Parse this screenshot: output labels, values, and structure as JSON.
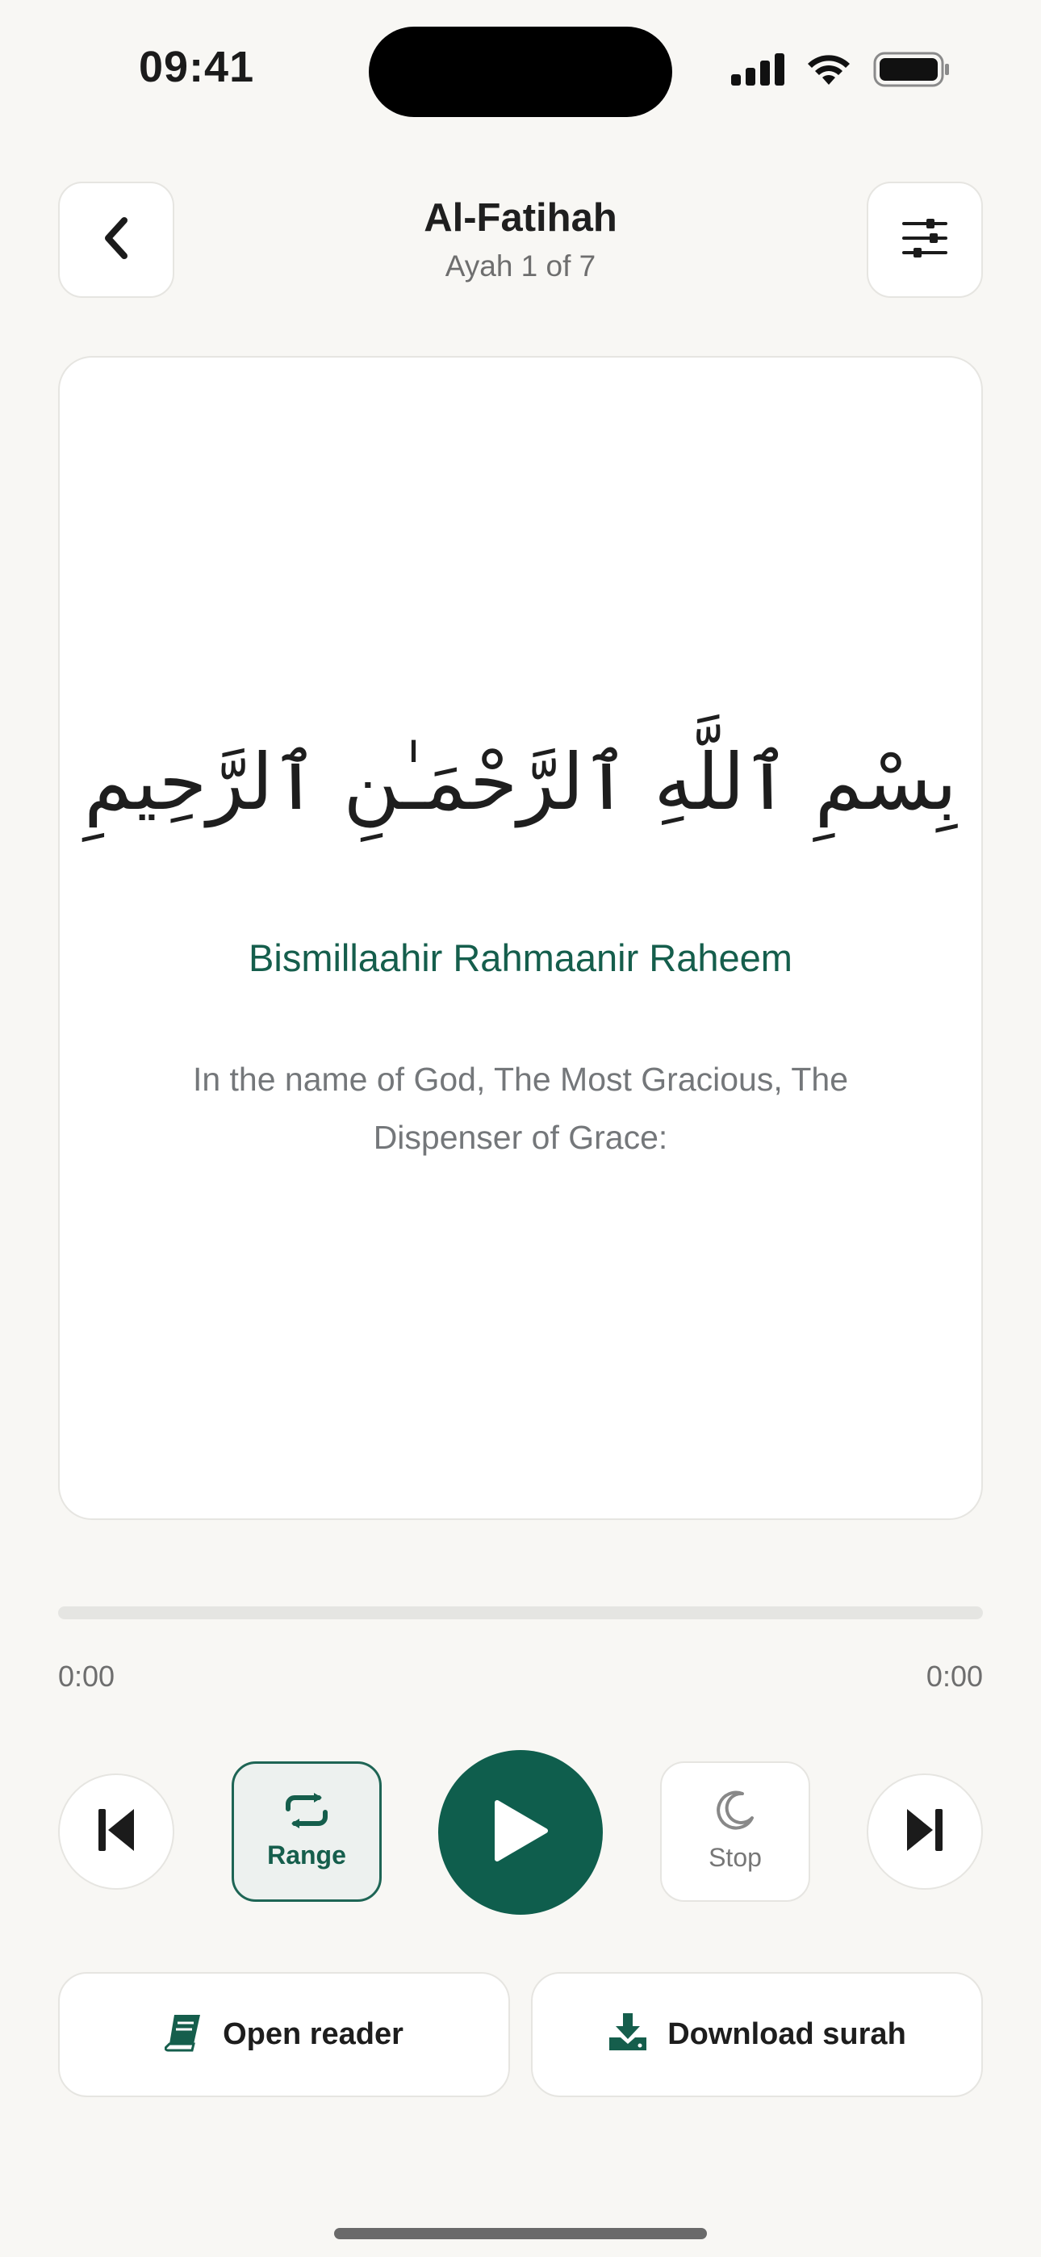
{
  "status_bar": {
    "time": "09:41",
    "icons": [
      "cellular-signal-icon",
      "wifi-icon",
      "battery-icon"
    ]
  },
  "header": {
    "title": "Al-Fatihah",
    "subtitle": "Ayah 1 of 7",
    "back_icon": "chevron-left-icon",
    "settings_icon": "sliders-icon"
  },
  "ayah": {
    "arabic": "بِسْمِ ٱللَّهِ ٱلرَّحْمَـٰنِ ٱلرَّحِيمِ",
    "transliteration": "Bismillaahir Rahmaanir Raheem",
    "translation": "In the name of God, The Most Gracious, The Dispenser of Grace:"
  },
  "player": {
    "elapsed": "0:00",
    "duration": "0:00",
    "progress": 0,
    "range_label": "Range",
    "stop_label": "Stop",
    "icons": {
      "previous": "skip-previous-icon",
      "range": "repeat-icon",
      "play": "play-icon",
      "stop": "moon-icon",
      "next": "skip-next-icon"
    }
  },
  "actions": {
    "open_reader": "Open reader",
    "download_surah": "Download surah",
    "icons": {
      "open_reader": "book-icon",
      "download_surah": "download-icon"
    }
  },
  "colors": {
    "accent": "#0f5e4d",
    "background": "#f8f7f4",
    "card": "#ffffff",
    "muted_text": "#74777a"
  }
}
